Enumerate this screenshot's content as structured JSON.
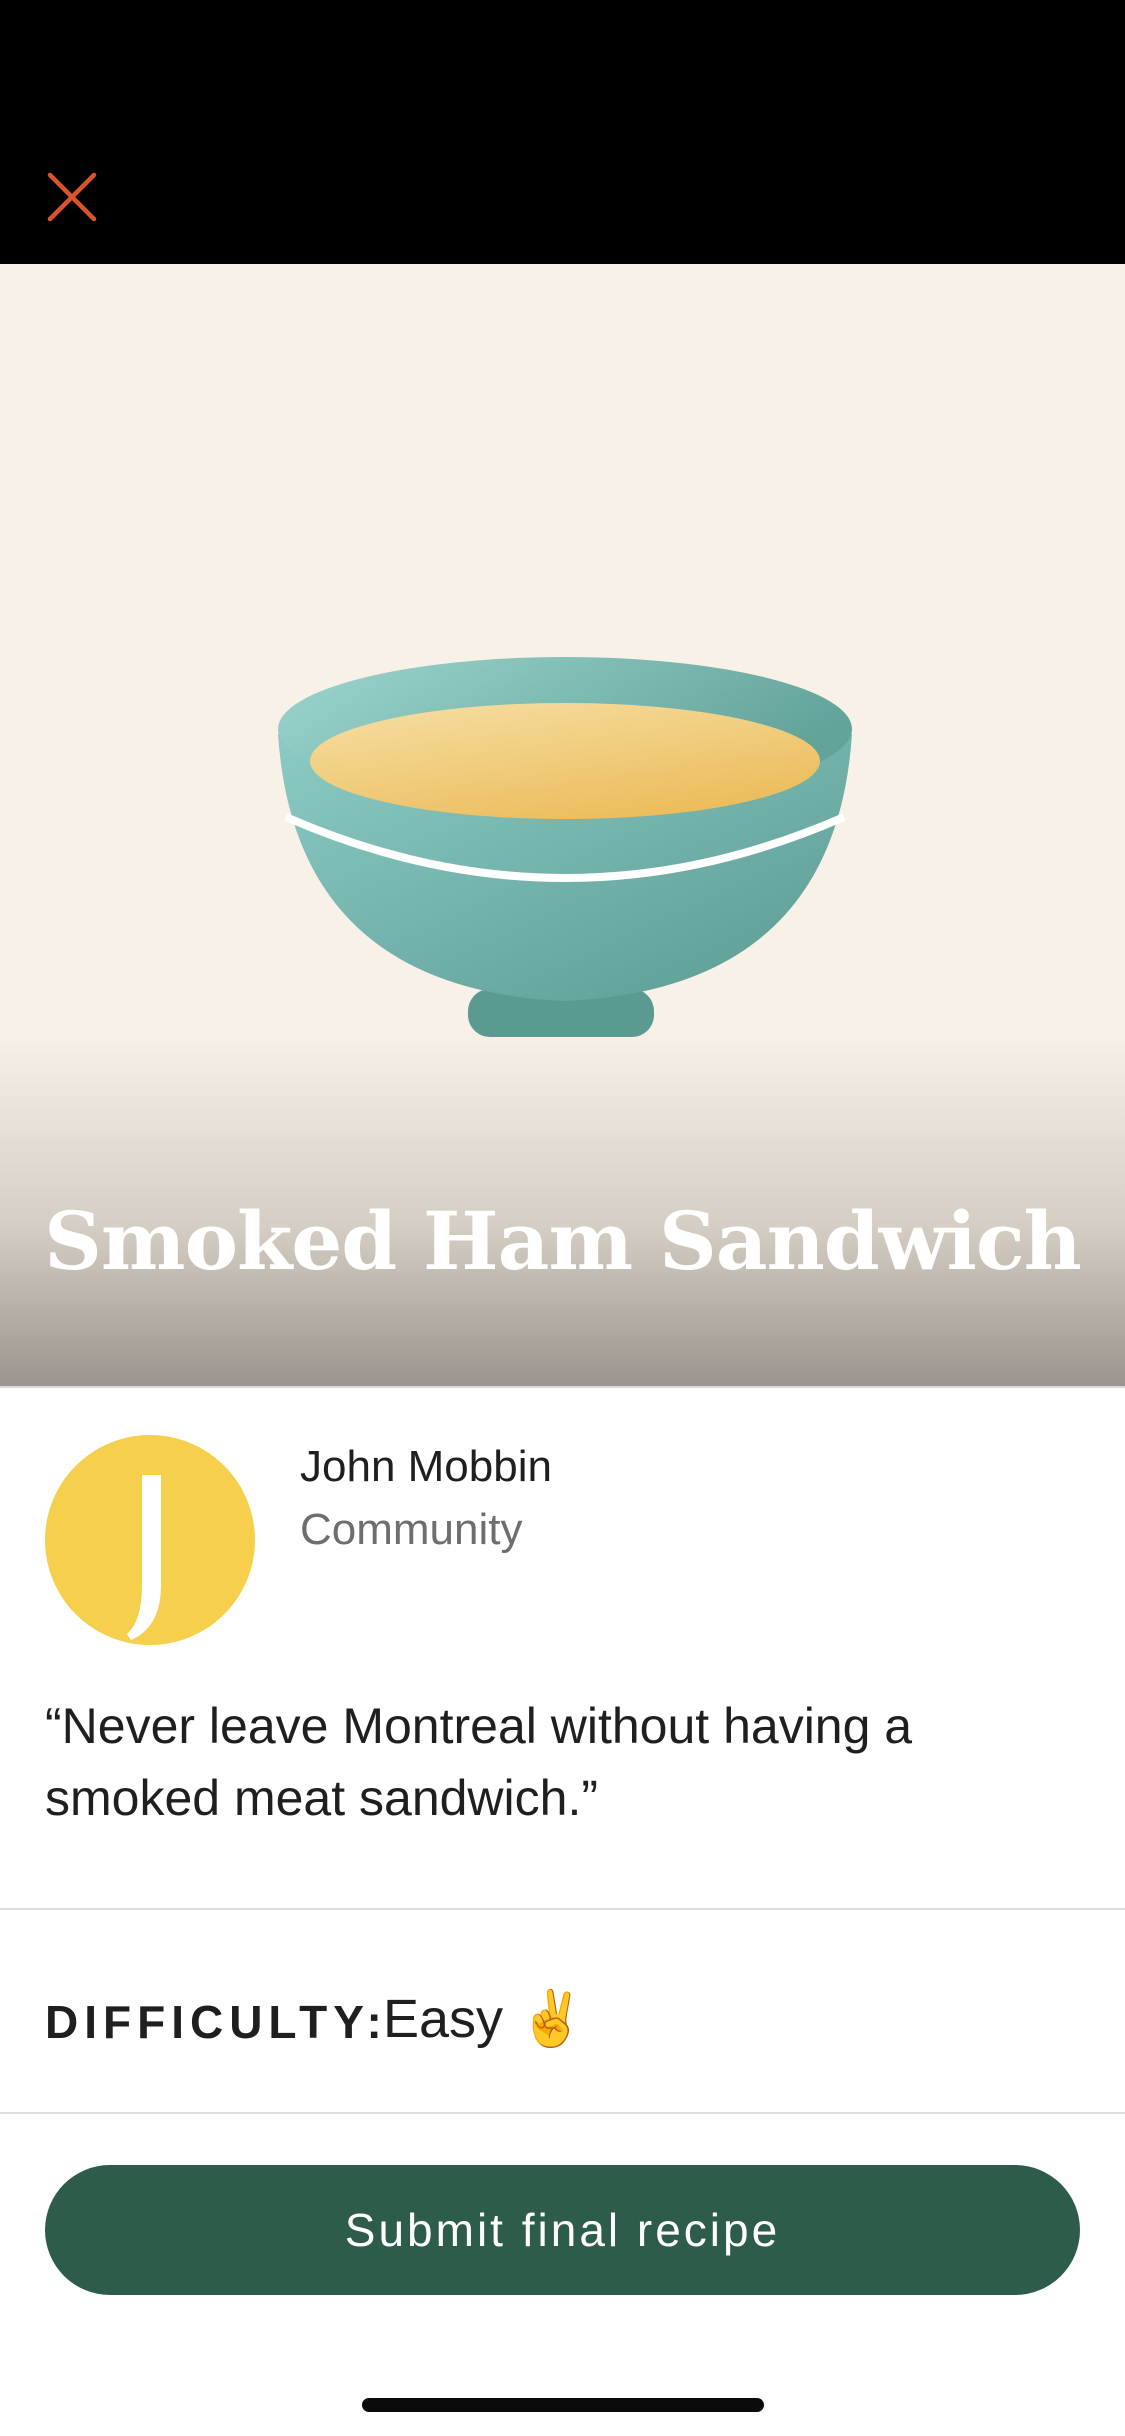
{
  "header": {
    "close_icon": "close-icon",
    "accent_color": "#d9532b"
  },
  "hero": {
    "illustration": "soup-bowl-icon",
    "title": "Smoked Ham Sandwich",
    "background_color": "#f8f1e7"
  },
  "author": {
    "avatar_letter": "J",
    "name": "John Mobbin",
    "type": "Community",
    "avatar_color": "#f6d04d"
  },
  "quote": "“Never leave Montreal without having a smoked meat sandwich.”",
  "difficulty": {
    "label": "DIFFICULTY:",
    "value": "Easy ✌️"
  },
  "actions": {
    "submit_label": "Submit final recipe",
    "submit_color": "#2d5c4a"
  }
}
